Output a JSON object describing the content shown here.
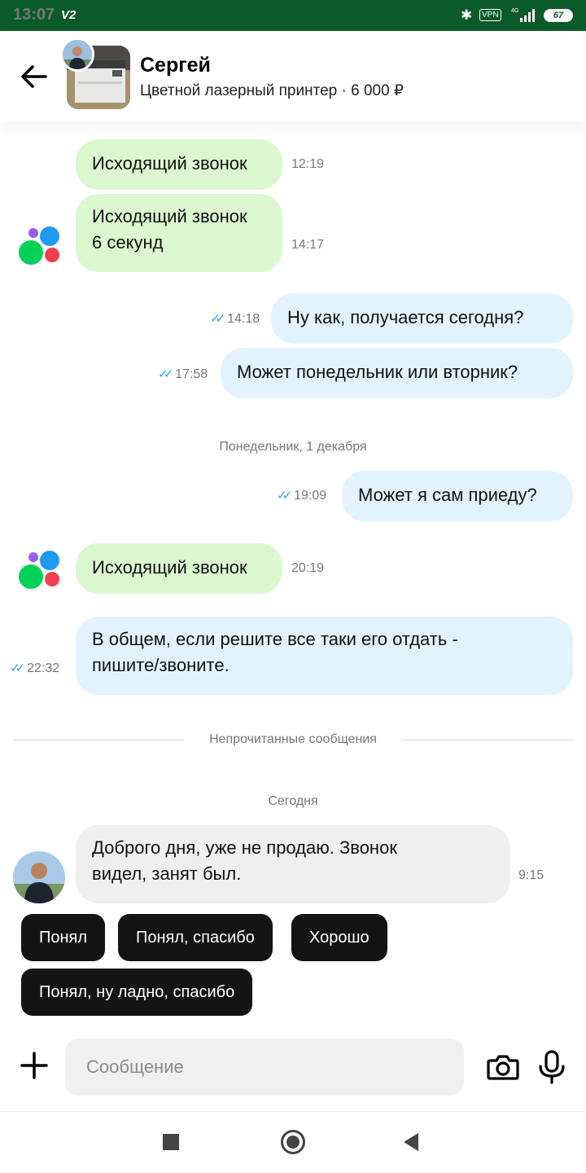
{
  "status_bar": {
    "time": "13:07",
    "carrier": "V2",
    "vpn": "VPN",
    "network": "4G",
    "battery": "67"
  },
  "header": {
    "name": "Сергей",
    "subtitle": "Цветной лазерный принтер · 6 000 ₽"
  },
  "messages": {
    "m1": {
      "text": "Исходящий звонок",
      "time": "12:19"
    },
    "m2": {
      "text": "Исходящий звонок\n6 секунд",
      "time": "14:17"
    },
    "m3": {
      "text": "Ну как, получается сегодня?",
      "time": "14:18"
    },
    "m4": {
      "text": "Может понедельник или вторник?",
      "time": "17:58"
    },
    "date1": "Понедельник, 1 декабря",
    "m5": {
      "text": "Может я сам приеду?",
      "time": "19:09"
    },
    "m6": {
      "text": "Исходящий звонок",
      "time": "20:19"
    },
    "m7": {
      "text": "В общем, если решите все таки его отдать -\nпишите/звоните.",
      "time": "22:32"
    },
    "unread": "Непрочитанные сообщения",
    "date2": "Сегодня",
    "m8": {
      "text": "Доброго дня, уже не продаю. Звонок\nвидел, занят был.",
      "time": "9:15"
    }
  },
  "quick_replies": [
    "Понял",
    "Понял, спасибо",
    "Хорошо",
    "Понял, ну ладно, спасибо"
  ],
  "composer": {
    "placeholder": "Сообщение"
  },
  "colors": {
    "status_bar": "#0b5a2a",
    "outgoing_call": "#dbf7cf",
    "outgoing": "#e2f3fd",
    "incoming": "#efefef",
    "chip": "#141414",
    "check": "#2aa3e6"
  }
}
